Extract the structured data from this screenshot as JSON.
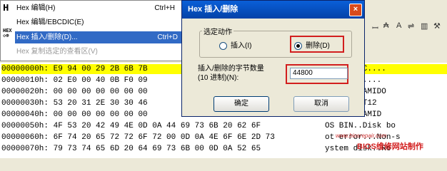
{
  "menu": {
    "items": [
      {
        "icon": "H",
        "label": "Hex 编辑(H)",
        "shortcut": "Ctrl+H",
        "state": "normal"
      },
      {
        "icon": "",
        "label": "Hex 编辑/EBCDIC(E)",
        "shortcut": "",
        "state": "normal"
      },
      {
        "icon": "Hex",
        "label": "Hex 插入/删除(D)...",
        "shortcut": "Ctrl+D",
        "state": "selected"
      },
      {
        "icon": "",
        "label": "Hex 复制选定的查看区(V)",
        "shortcut": "",
        "state": "disabled"
      }
    ]
  },
  "dialog": {
    "title": "Hex 插入/删除",
    "close": "×",
    "group_title": "选定动作",
    "radio_insert": "插入(I)",
    "radio_delete": "删除(D)",
    "count_label_1": "插入/删除的字节数量",
    "count_label_2": "(10 进制)(N):",
    "count_value": "44800",
    "ok": "确定",
    "cancel": "取消"
  },
  "hex": {
    "rows": [
      {
        "addr": "00000000h:",
        "bytes": "E9 94 00 29 2B 6B 7B",
        "ascii": "?)+k(OIHC....",
        "hl": true
      },
      {
        "addr": "00000010h:",
        "bytes": "02 E0 00 40 0B F0 09",
        "ascii": "@.?.........",
        "hl": false
      },
      {
        "addr": "00000020h:",
        "bytes": "00 00 00 00 00 00 00",
        "ascii": "....)Q.?AMIDO",
        "hl": false
      },
      {
        "addr": "00000030h:",
        "bytes": "53 20 31 2E 30 30 46",
        "ascii": "S 1.00FAT12",
        "hl": false
      },
      {
        "addr": "00000040h:",
        "bytes": "00 00 00 00 00 00 00",
        "ascii": "........AMID",
        "hl": false
      },
      {
        "addr": "00000050h:",
        "bytes": "4F 53 20 42 49 4E 0D 0A 44 69 73 6B 20 62 6F",
        "ascii": "OS BIN..Disk bo",
        "hl": false
      },
      {
        "addr": "00000060h:",
        "bytes": "6F 74 20 65 72 72 6F 72 00 0D 0A 4E 6F 6E 2D 73",
        "ascii": "ot error...Non-s",
        "hl": false
      },
      {
        "addr": "00000070h:",
        "bytes": "79 73 74 65 6D 20 64 69 73 6B 00 0D 0A 52 65",
        "ascii": "ystem disk..Re",
        "hl": false
      }
    ]
  },
  "watermark": {
    "url": "www.biosrepair.com",
    "text": "BIOS维修网站制作"
  }
}
